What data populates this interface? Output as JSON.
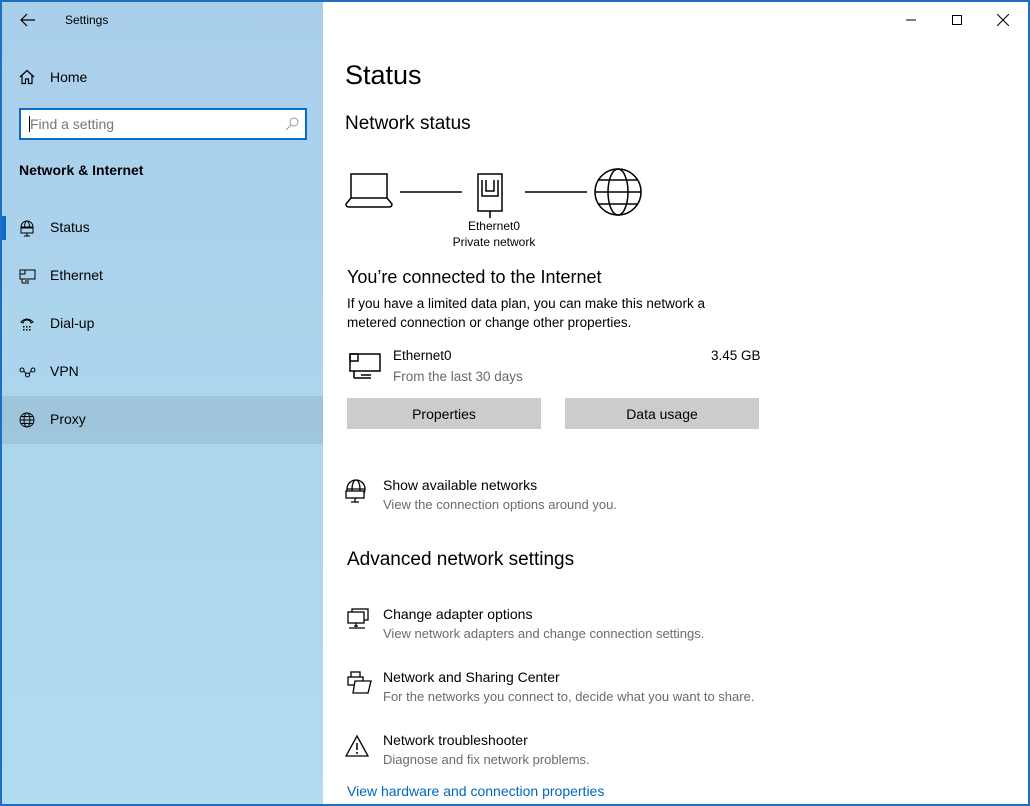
{
  "window": {
    "title": "Settings",
    "controls": [
      "minimize",
      "maximize",
      "close"
    ]
  },
  "sidebar": {
    "home_label": "Home",
    "search": {
      "placeholder": "Find a setting"
    },
    "section_title": "Network & Internet",
    "items": [
      {
        "label": "Status",
        "icon": "globe-monitor-icon",
        "selected": true
      },
      {
        "label": "Ethernet",
        "icon": "ethernet-icon"
      },
      {
        "label": "Dial-up",
        "icon": "dialup-icon"
      },
      {
        "label": "VPN",
        "icon": "vpn-icon"
      },
      {
        "label": "Proxy",
        "icon": "globe-icon",
        "hovered": true
      }
    ]
  },
  "main": {
    "page_title": "Status",
    "network_status_title": "Network status",
    "diagram": {
      "adapter_name": "Ethernet0",
      "network_type": "Private network"
    },
    "connected_title": "You’re connected to the Internet",
    "connected_desc": "If you have a limited data plan, you can make this network a metered connection or change other properties.",
    "connection": {
      "name": "Ethernet0",
      "period": "From the last 30 days",
      "usage": "3.45 GB"
    },
    "buttons": {
      "properties": "Properties",
      "data_usage": "Data usage"
    },
    "show_networks": {
      "title": "Show available networks",
      "desc": "View the connection options around you."
    },
    "advanced_title": "Advanced network settings",
    "advanced_items": [
      {
        "title": "Change adapter options",
        "desc": "View network adapters and change connection settings.",
        "icon": "adapter-icon"
      },
      {
        "title": "Network and Sharing Center",
        "desc": "For the networks you connect to, decide what you want to share.",
        "icon": "sharing-center-icon"
      },
      {
        "title": "Network troubleshooter",
        "desc": "Diagnose and fix network problems.",
        "icon": "warning-icon"
      }
    ],
    "hardware_link": "View hardware and connection properties"
  },
  "colors": {
    "accent": "#0a6cc8",
    "link": "#0067c0",
    "sidebar": "#acd5ee",
    "button": "#cccccc"
  }
}
